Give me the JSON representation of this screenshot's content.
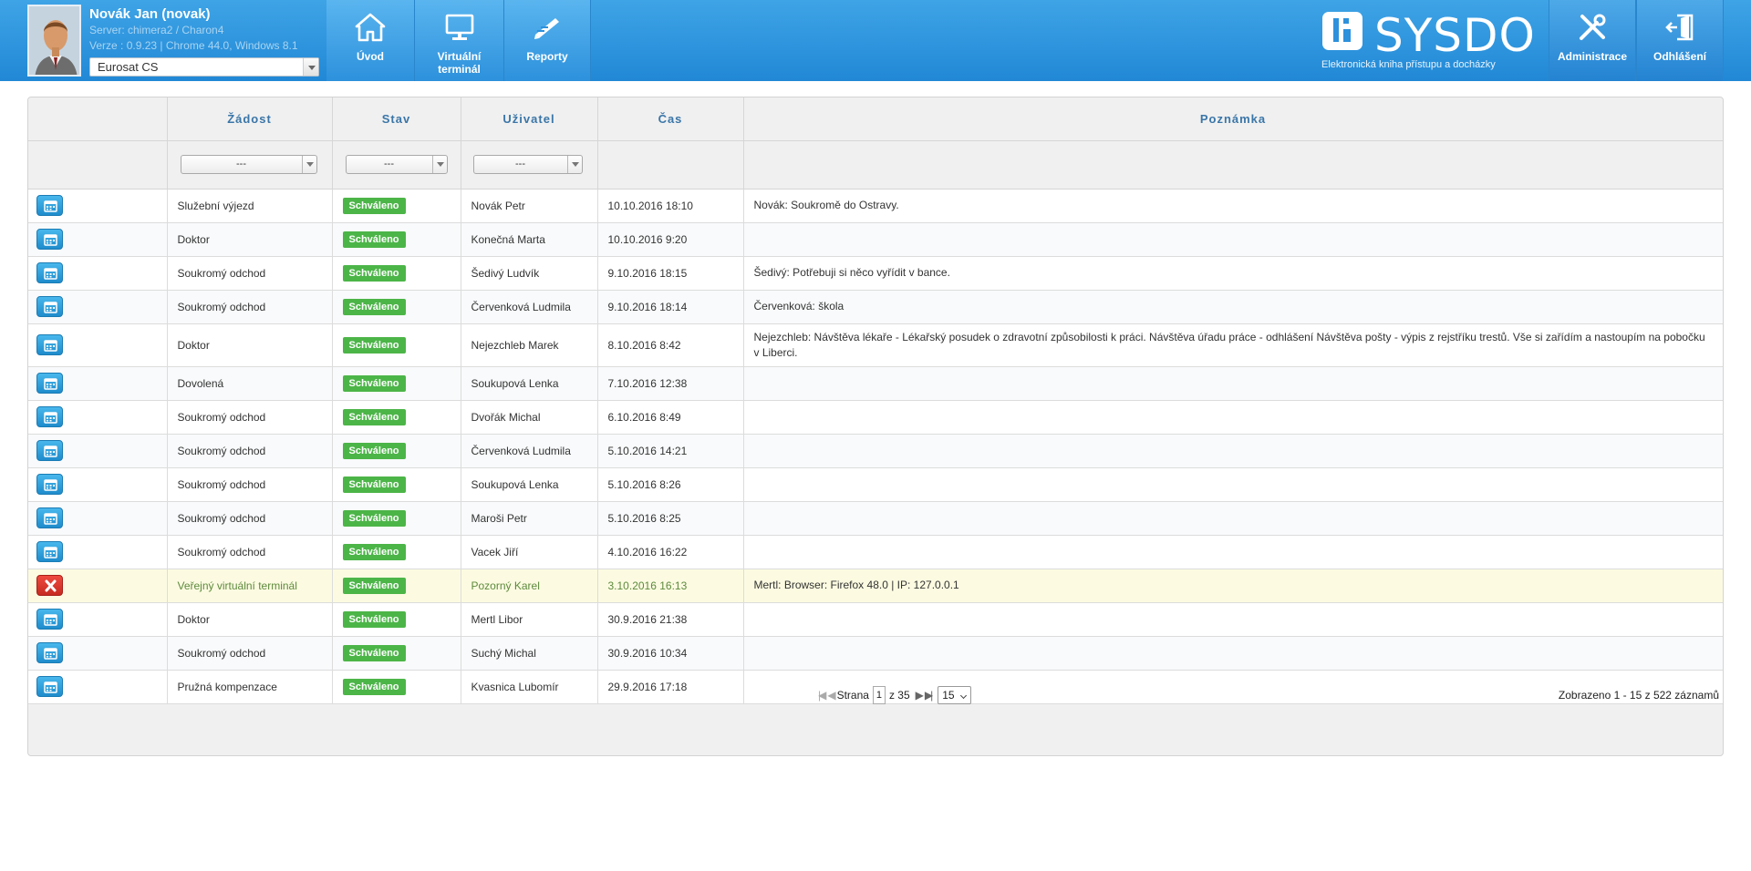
{
  "user": {
    "name": "Novák Jan (novak)",
    "server": "Server: chimera2 / Charon4",
    "version": "Verze : 0.9.23 | Chrome 44.0, Windows 8.1",
    "company": "Eurosat CS"
  },
  "nav": {
    "home": "Úvod",
    "terminal": "Virtuální terminál",
    "reports": "Reporty",
    "admin": "Administrace",
    "logout": "Odhlášení"
  },
  "logo": {
    "text": "SYSDO",
    "subtitle": "Elektronická kniha přístupu a docházky"
  },
  "table": {
    "headers": [
      "",
      "Žádost",
      "Stav",
      "Uživatel",
      "Čas",
      "Poznámka"
    ],
    "filter_placeholder": "---",
    "rows": [
      {
        "icon": "calendar-icon",
        "request": "Služební výjezd",
        "status": "Schváleno",
        "user": "Novák Petr",
        "time": "10.10.2016 18:10",
        "note": "Novák: Soukromě do Ostravy."
      },
      {
        "icon": "calendar-icon",
        "request": "Doktor",
        "status": "Schváleno",
        "user": "Konečná Marta",
        "time": "10.10.2016 9:20",
        "note": ""
      },
      {
        "icon": "calendar-icon",
        "request": "Soukromý odchod",
        "status": "Schváleno",
        "user": "Šedivý Ludvík",
        "time": "9.10.2016 18:15",
        "note": "Šedivý: Potřebuji si něco vyřídit v bance."
      },
      {
        "icon": "calendar-icon",
        "request": "Soukromý odchod",
        "status": "Schváleno",
        "user": "Červenková Ludmila",
        "time": "9.10.2016 18:14",
        "note": "Červenková: škola"
      },
      {
        "icon": "calendar-icon",
        "request": "Doktor",
        "status": "Schváleno",
        "user": "Nejezchleb Marek",
        "time": "8.10.2016 8:42",
        "note": "Nejezchleb: Návštěva lékaře - Lékařský posudek o zdravotní způsobilosti k práci. Návštěva úřadu práce - odhlášení Návštěva pošty - výpis z rejstříku trestů. Vše si zařídím a nastoupím na pobočku v Liberci."
      },
      {
        "icon": "calendar-icon",
        "request": "Dovolená",
        "status": "Schváleno",
        "user": "Soukupová Lenka",
        "time": "7.10.2016 12:38",
        "note": ""
      },
      {
        "icon": "calendar-icon",
        "request": "Soukromý odchod",
        "status": "Schváleno",
        "user": "Dvořák Michal",
        "time": "6.10.2016 8:49",
        "note": ""
      },
      {
        "icon": "calendar-icon",
        "request": "Soukromý odchod",
        "status": "Schváleno",
        "user": "Červenková Ludmila",
        "time": "5.10.2016 14:21",
        "note": ""
      },
      {
        "icon": "calendar-icon",
        "request": "Soukromý odchod",
        "status": "Schváleno",
        "user": "Soukupová Lenka",
        "time": "5.10.2016 8:26",
        "note": ""
      },
      {
        "icon": "calendar-icon",
        "request": "Soukromý odchod",
        "status": "Schváleno",
        "user": "Maroši Petr",
        "time": "5.10.2016 8:25",
        "note": ""
      },
      {
        "icon": "calendar-icon",
        "request": "Soukromý odchod",
        "status": "Schváleno",
        "user": "Vacek Jiří",
        "time": "4.10.2016 16:22",
        "note": ""
      },
      {
        "icon": "close-icon",
        "request": "Veřejný virtuální terminál",
        "status": "Schváleno",
        "user": "Pozorný Karel",
        "time": "3.10.2016 16:13",
        "note": "Mertl: Browser: Firefox 48.0 | IP: 127.0.0.1"
      },
      {
        "icon": "calendar-icon",
        "request": "Doktor",
        "status": "Schváleno",
        "user": "Mertl Libor",
        "time": "30.9.2016 21:38",
        "note": ""
      },
      {
        "icon": "calendar-icon",
        "request": "Soukromý odchod",
        "status": "Schváleno",
        "user": "Suchý Michal",
        "time": "30.9.2016 10:34",
        "note": ""
      },
      {
        "icon": "calendar-icon",
        "request": "Pružná kompenzace",
        "status": "Schváleno",
        "user": "Kvasnica Lubomír",
        "time": "29.9.2016 17:18",
        "note": ""
      }
    ]
  },
  "pager": {
    "first": "|◀",
    "prev": "◀",
    "page_label": "Strana",
    "page": "1",
    "of": "z 35",
    "next": "▶",
    "last": "▶|",
    "page_size": "15",
    "summary": "Zobrazeno 1 - 15 z 522 záznamů"
  },
  "colors": {
    "header": "#2d91dc",
    "badge": "#4cb548",
    "row_button": "#2a9bd9",
    "highlight_row": "#fcfbe1"
  }
}
